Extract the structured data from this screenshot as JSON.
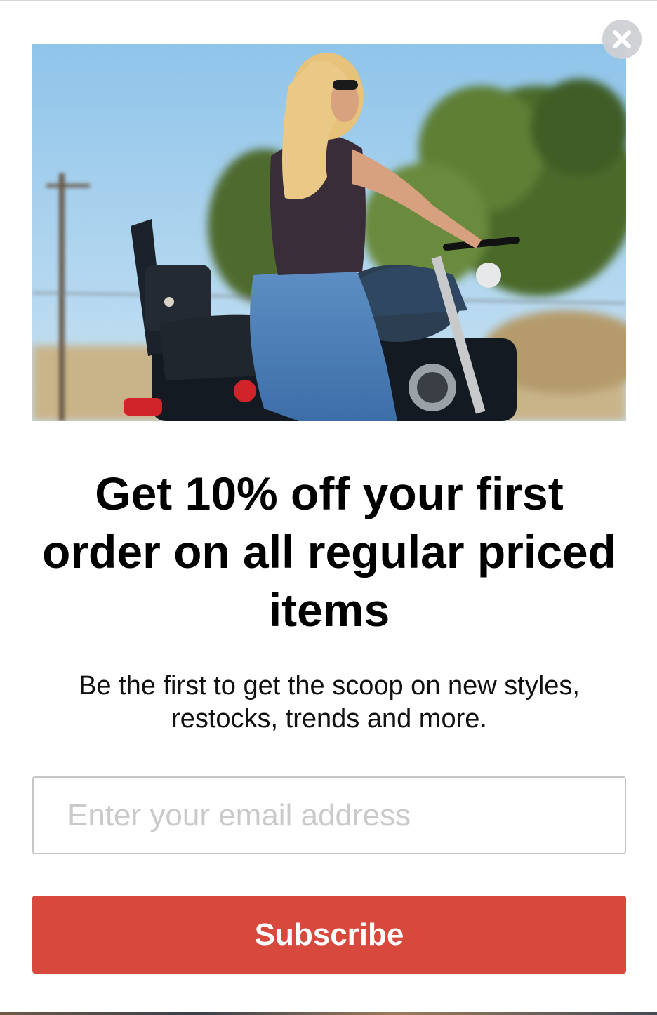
{
  "popup": {
    "close_icon": "close-icon",
    "hero_image": "woman-on-motorcycle-photo",
    "headline": "Get 10% off your first order on all regular priced items",
    "subtext": "Be the first to get the scoop on new styles, restocks, trends and more.",
    "email_placeholder": "Enter your email address",
    "email_value": "",
    "subscribe_label": "Subscribe",
    "colors": {
      "button": "#d8493d",
      "button_text": "#ffffff",
      "headline": "#000000",
      "input_border": "#c4c6c9"
    }
  }
}
